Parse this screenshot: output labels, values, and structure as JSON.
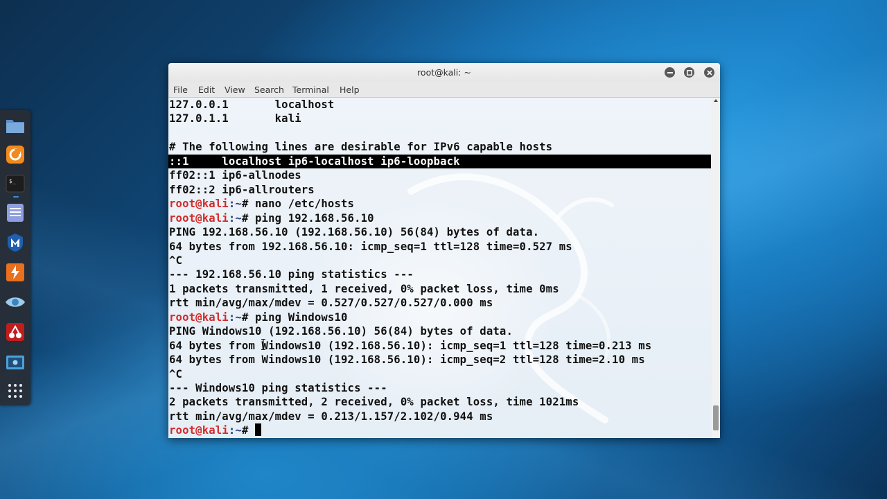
{
  "window": {
    "title": "root@kali: ~"
  },
  "menu": [
    "File",
    "Edit",
    "View",
    "Search",
    "Terminal",
    "Help"
  ],
  "dock": [
    {
      "icon": "files-folder-icon"
    },
    {
      "icon": "firefox-icon"
    },
    {
      "icon": "terminal-icon"
    },
    {
      "icon": "text-editor-icon"
    },
    {
      "icon": "metasploit-icon"
    },
    {
      "icon": "burpsuite-icon"
    },
    {
      "icon": "eye-icon"
    },
    {
      "icon": "cherrytree-icon"
    },
    {
      "icon": "screenshot-icon"
    },
    {
      "icon": "show-applications-icon"
    }
  ],
  "prompt": {
    "user": "root@kali",
    "path": ":~",
    "symbol": "# "
  },
  "terminal": {
    "lines": [
      {
        "type": "out",
        "text": "127.0.0.1       localhost"
      },
      {
        "type": "out",
        "text": "127.0.1.1       kali"
      },
      {
        "type": "out",
        "text": ""
      },
      {
        "type": "out",
        "text": "# The following lines are desirable for IPv6 capable hosts"
      },
      {
        "type": "hl",
        "text": "::1     localhost ip6-localhost ip6-loopback"
      },
      {
        "type": "out",
        "text": "ff02::1 ip6-allnodes"
      },
      {
        "type": "out",
        "text": "ff02::2 ip6-allrouters"
      },
      {
        "type": "cmd",
        "text": "nano /etc/hosts"
      },
      {
        "type": "cmd",
        "text": "ping 192.168.56.10"
      },
      {
        "type": "out",
        "text": "PING 192.168.56.10 (192.168.56.10) 56(84) bytes of data."
      },
      {
        "type": "out",
        "text": "64 bytes from 192.168.56.10: icmp_seq=1 ttl=128 time=0.527 ms"
      },
      {
        "type": "out",
        "text": "^C"
      },
      {
        "type": "out",
        "text": "--- 192.168.56.10 ping statistics ---"
      },
      {
        "type": "out",
        "text": "1 packets transmitted, 1 received, 0% packet loss, time 0ms"
      },
      {
        "type": "out",
        "text": "rtt min/avg/max/mdev = 0.527/0.527/0.527/0.000 ms"
      },
      {
        "type": "cmd",
        "text": "ping Windows10"
      },
      {
        "type": "out",
        "text": "PING Windows10 (192.168.56.10) 56(84) bytes of data."
      },
      {
        "type": "out",
        "text": "64 bytes from Windows10 (192.168.56.10): icmp_seq=1 ttl=128 time=0.213 ms"
      },
      {
        "type": "out",
        "text": "64 bytes from Windows10 (192.168.56.10): icmp_seq=2 ttl=128 time=2.10 ms"
      },
      {
        "type": "out",
        "text": "^C"
      },
      {
        "type": "out",
        "text": "--- Windows10 ping statistics ---"
      },
      {
        "type": "out",
        "text": "2 packets transmitted, 2 received, 0% packet loss, time 1021ms"
      },
      {
        "type": "out",
        "text": "rtt min/avg/max/mdev = 0.213/1.157/2.102/0.944 ms"
      },
      {
        "type": "prompt",
        "text": ""
      }
    ]
  },
  "colors": {
    "prompt_user": "#d22a2a",
    "highlight_bg": "#000000",
    "terminal_text": "#111111"
  }
}
